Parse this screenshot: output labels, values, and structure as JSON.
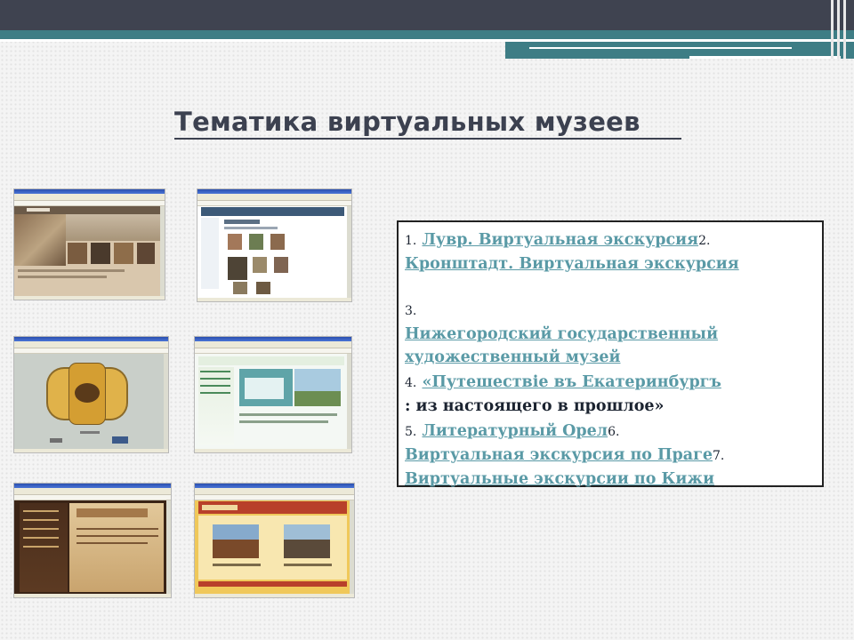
{
  "slide": {
    "title": "Тематика виртуальных музеев"
  },
  "thumbnails": [
    {
      "id": "louvre",
      "theme": "brown-gallery"
    },
    {
      "id": "kronstadt",
      "theme": "white-collection"
    },
    {
      "id": "nizhny",
      "theme": "grey-ornament"
    },
    {
      "id": "ekaterinburg",
      "theme": "green-menu"
    },
    {
      "id": "orel",
      "theme": "dark-manuscript"
    },
    {
      "id": "kizhi",
      "theme": "orange-villages"
    }
  ],
  "links": [
    {
      "num": "1.",
      "text": "Лувр. Виртуальная экскурсия"
    },
    {
      "num": "2.",
      "text": "Кронштадт. Виртуальная экскурсия"
    },
    {
      "num": "3.",
      "text": "Нижегородский государственный художественный музей"
    },
    {
      "num": "4.",
      "text": "«Путешествiе въ Екатеринбургъ",
      "tail": ": из настоящего в прошлое»"
    },
    {
      "num": "5.",
      "text": "Литературный Орел"
    },
    {
      "num": "6.",
      "text": "Виртуальная экскурсия по Праге"
    },
    {
      "num": "7.",
      "text": "Виртуальные экскурсии по Кижи"
    }
  ],
  "colors": {
    "accent_teal": "#3e7d85",
    "header_dark": "#3f4350",
    "title_text": "#3c4150",
    "link": "#5a9aa6"
  }
}
